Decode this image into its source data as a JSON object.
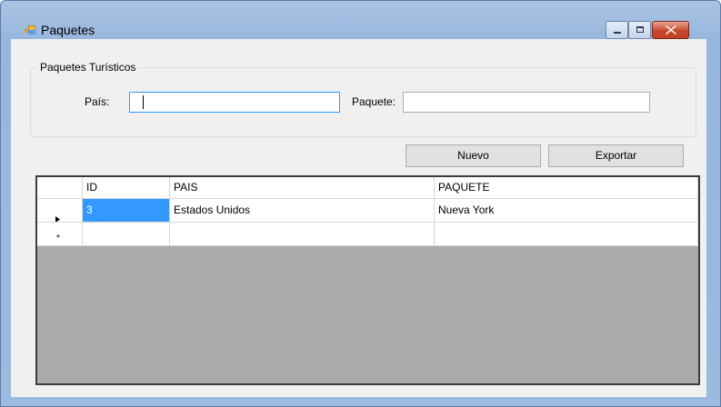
{
  "window": {
    "title": "Paquetes",
    "icon": "app-form-icon",
    "controls": [
      "minimize-icon",
      "maximize-icon",
      "close-icon"
    ]
  },
  "groupbox": {
    "legend": "Paquetes Turísticos",
    "pais_label": "País:",
    "pais_value": "",
    "paquete_label": "Paquete:",
    "paquete_value": ""
  },
  "buttons": {
    "nuevo": "Nuevo",
    "exportar": "Exportar"
  },
  "grid": {
    "columns": [
      "ID",
      "PAIS",
      "PAQUETE"
    ],
    "rows": [
      {
        "id": "3",
        "pais": "Estados Unidos",
        "paquete": "Nueva York"
      }
    ],
    "new_row_marker": "*",
    "current_row_marker": "▶"
  },
  "colors": {
    "selection": "#3399ff",
    "grid_background": "#ababab",
    "window_frame": "#9cb9de"
  }
}
